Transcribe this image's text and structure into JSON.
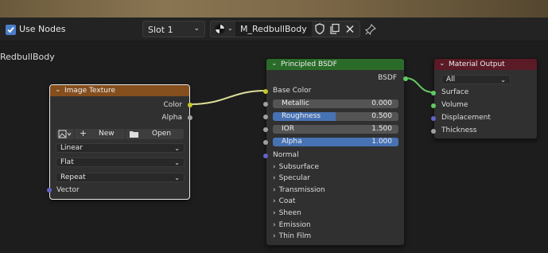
{
  "header": {
    "use_nodes_label": "Use Nodes",
    "slot_label": "Slot 1",
    "material_name": "M_RedbullBody"
  },
  "editor": {
    "material_label": "RedbullBody"
  },
  "colors": {
    "image_texture_header": "#854e1d",
    "principled_header": "#2a6b2a",
    "output_header": "#5a1a26",
    "accent_blue": "#4772b3",
    "socket_yellow": "#c7c729",
    "socket_green": "#64c864"
  },
  "image_texture": {
    "title": "Image Texture",
    "out_color": "Color",
    "out_alpha": "Alpha",
    "new_label": "New",
    "open_label": "Open",
    "interpolation": "Linear",
    "projection": "Flat",
    "extension": "Repeat",
    "in_vector": "Vector"
  },
  "principled": {
    "title": "Principled BSDF",
    "out_bsdf": "BSDF",
    "base_color": "Base Color",
    "metallic_label": "Metallic",
    "metallic_value": "0.000",
    "roughness_label": "Roughness",
    "roughness_value": "0.500",
    "roughness_fill": 0.5,
    "ior_label": "IOR",
    "ior_value": "1.500",
    "alpha_label": "Alpha",
    "alpha_value": "1.000",
    "alpha_fill": 1.0,
    "normal": "Normal",
    "panels": [
      "Subsurface",
      "Specular",
      "Transmission",
      "Coat",
      "Sheen",
      "Emission",
      "Thin Film"
    ]
  },
  "output": {
    "title": "Material Output",
    "target": "All",
    "surface": "Surface",
    "volume": "Volume",
    "displacement": "Displacement",
    "thickness": "Thickness"
  }
}
